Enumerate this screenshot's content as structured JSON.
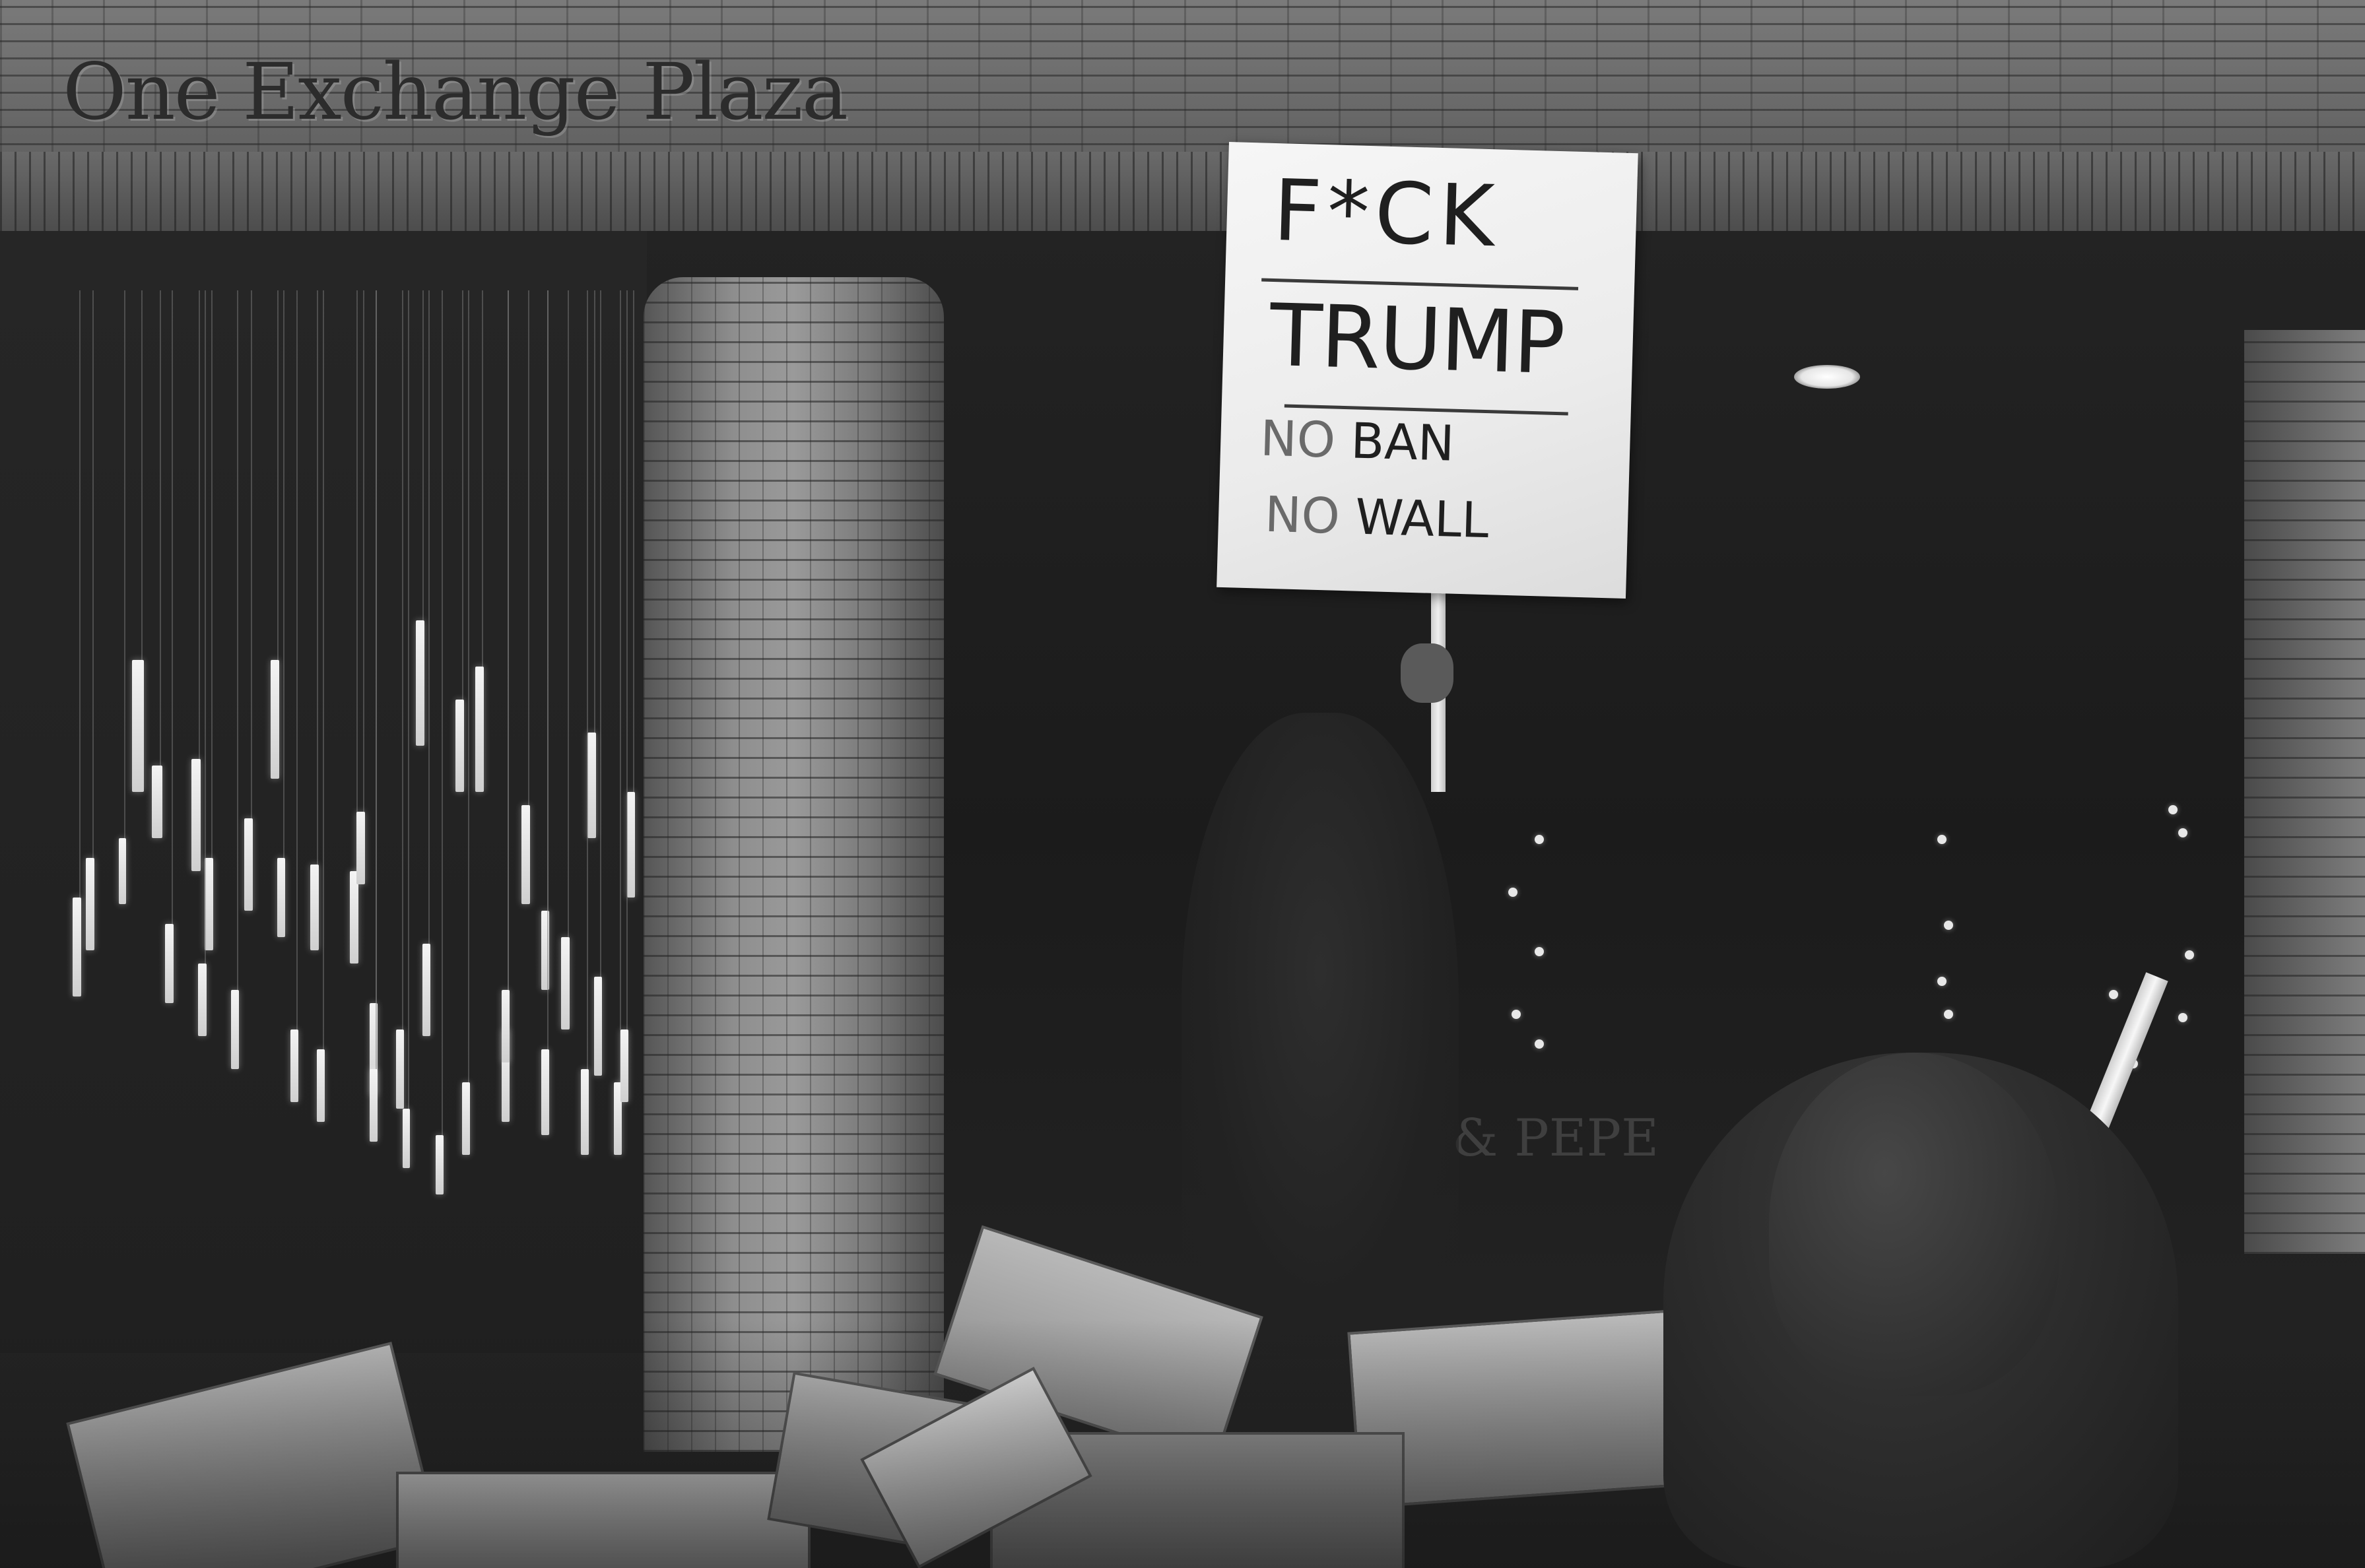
{
  "scene": {
    "description_tag": "",
    "building": {
      "name": "One Exchange Plaza"
    },
    "sign": {
      "line1": "F*CK",
      "line2": "TRUMP",
      "line3_faint": "NO",
      "line3": "BAN",
      "line4_faint": "NO",
      "line4": "WALL"
    },
    "window_lettering": "& PEPE",
    "colors": {
      "facade": "#6b6b6b",
      "lobby": "#1c1c1c",
      "sign": "#f0f0f0",
      "ink": "#1f1f1f"
    }
  }
}
